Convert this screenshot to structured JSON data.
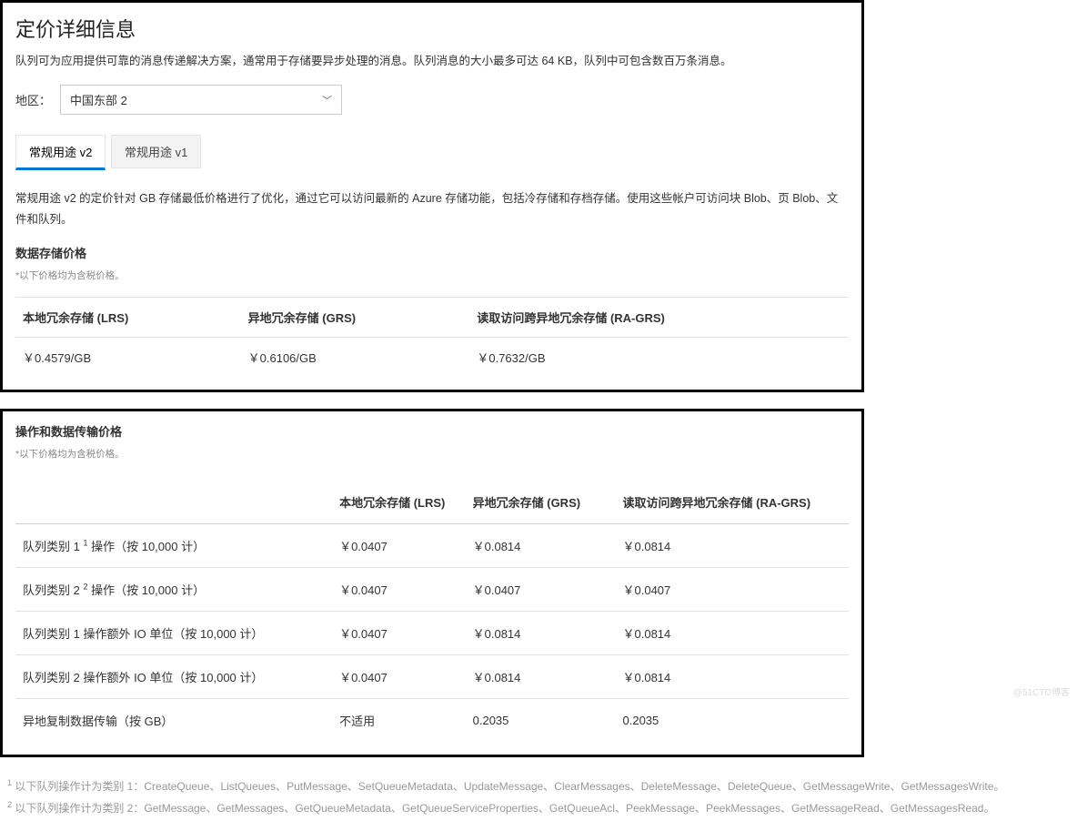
{
  "panel1": {
    "title": "定价详细信息",
    "intro": "队列可为应用提供可靠的消息传递解决方案，通常用于存储要异步处理的消息。队列消息的大小最多可达 64 KB，队列中可包含数百万条消息。",
    "region_label": "地区：",
    "region_value": "中国东部 2",
    "tabs": {
      "t1": "常规用途 v2",
      "t2": "常规用途 v1"
    },
    "desc": "常规用途 v2 的定价针对 GB 存储最低价格进行了优化，通过它可以访问最新的 Azure 存储功能，包括冷存储和存档存储。使用这些帐户可访问块 Blob、页 Blob、文件和队列。",
    "section": "数据存储价格",
    "note": "*以下价格均为含税价格。",
    "storage": {
      "headers": {
        "lrs": "本地冗余存储 (LRS)",
        "grs": "异地冗余存储 (GRS)",
        "ragrs": "读取访问跨异地冗余存储 (RA-GRS)"
      },
      "row": {
        "lrs": "￥0.4579/GB",
        "grs": "￥0.6106/GB",
        "ragrs": "￥0.7632/GB"
      }
    }
  },
  "panel2": {
    "section": "操作和数据传输价格",
    "note": "*以下价格均为含税价格。",
    "headers": {
      "blank": "",
      "lrs": "本地冗余存储 (LRS)",
      "grs": "异地冗余存储 (GRS)",
      "ragrs": "读取访问跨异地冗余存储 (RA-GRS)"
    },
    "rows": [
      {
        "label_a": "队列类别 1 ",
        "sup": "1",
        "label_b": " 操作（按 10,000 计）",
        "lrs": "￥0.0407",
        "grs": "￥0.0814",
        "ragrs": "￥0.0814"
      },
      {
        "label_a": "队列类别 2 ",
        "sup": "2",
        "label_b": " 操作（按 10,000 计）",
        "lrs": "￥0.0407",
        "grs": "￥0.0407",
        "ragrs": "￥0.0407"
      },
      {
        "label_a": "队列类别 1 操作额外 IO 单位（按 10,000 计）",
        "sup": "",
        "label_b": "",
        "lrs": "￥0.0407",
        "grs": "￥0.0814",
        "ragrs": "￥0.0814"
      },
      {
        "label_a": "队列类别 2 操作额外 IO 单位（按 10,000 计）",
        "sup": "",
        "label_b": "",
        "lrs": "￥0.0407",
        "grs": "￥0.0814",
        "ragrs": "￥0.0814"
      },
      {
        "label_a": "异地复制数据传输（按 GB）",
        "sup": "",
        "label_b": "",
        "lrs": "不适用",
        "grs": "0.2035",
        "ragrs": "0.2035"
      }
    ]
  },
  "footnotes": {
    "f1_sup": "1",
    "f1": " 以下队列操作计为类别 1：CreateQueue、ListQueues、PutMessage、SetQueueMetadata、UpdateMessage、ClearMessages、DeleteMessage、DeleteQueue、GetMessageWrite、GetMessagesWrite。",
    "f2_sup": "2",
    "f2": " 以下队列操作计为类别 2：GetMessage、GetMessages、GetQueueMetadata、GetQueueServiceProperties、GetQueueAcl、PeekMessage、PeekMessages、GetMessageRead、GetMessagesRead。"
  },
  "watermark": "@51CTO博客"
}
